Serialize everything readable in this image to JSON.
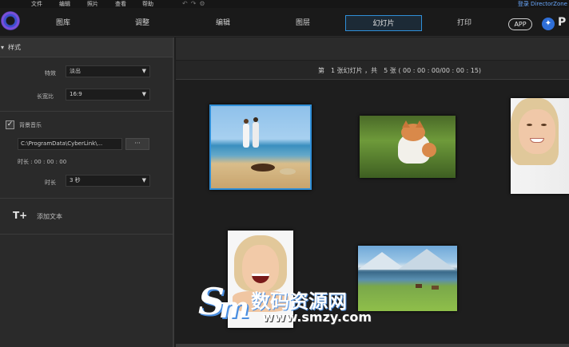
{
  "menubar": {
    "items": [
      "文件",
      "编辑",
      "照片",
      "查看",
      "帮助"
    ],
    "user_link": "登录 DirectorZone"
  },
  "nav": {
    "tabs": [
      "图库",
      "调整",
      "编辑",
      "图层",
      "幻灯片",
      "打印"
    ],
    "active_tab": "幻灯片",
    "app_button": "APP"
  },
  "panel": {
    "title": "样式",
    "effect_label": "特效",
    "effect_value": "淡出",
    "aspect_label": "长宽比",
    "aspect_value": "16:9",
    "music_label": "背景音乐",
    "music_checked": true,
    "music_path": "C:\\ProgramData\\CyberLink\\...",
    "browse_label": "···",
    "length_info": "时长 : 00 : 00 : 00",
    "duration_label": "时长",
    "duration_value": "3 秒",
    "add_text_label": "添加文本"
  },
  "main": {
    "info": "第　1 张幻灯片 ，共　5 张 ( 00 : 00 : 00/00 : 00 : 15)"
  },
  "watermark": {
    "logo_s": "S",
    "logo_m": "m",
    "text": "数码资源网",
    "url": "www.smzy.com"
  },
  "colors": {
    "accent": "#2f8fd8",
    "background": "#1e1e1e",
    "panel": "#2a2a2a"
  }
}
